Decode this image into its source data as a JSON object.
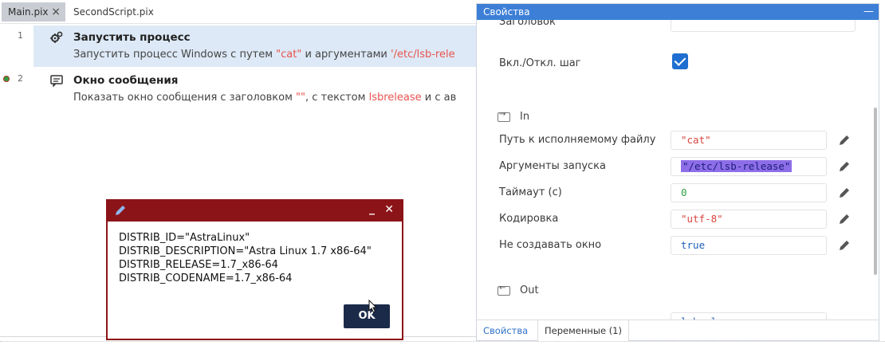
{
  "tabs": [
    {
      "label": "Main.pix",
      "active": true
    },
    {
      "label": "SecondScript.pix",
      "active": false
    }
  ],
  "steps": [
    {
      "number": "1",
      "title": "Запустить процесс",
      "desc_prefix": "Запустить процесс Windows с путем ",
      "desc_value1": "\"cat\"",
      "desc_mid": " и аргументами ",
      "desc_value2": "'/etc/lsb-rele",
      "icon": "gears-icon"
    },
    {
      "number": "2",
      "title": "Окно сообщения",
      "desc_prefix": "Показать окно сообщения с заголовком ",
      "desc_value1": "\"\"",
      "desc_mid": ", с текстом ",
      "desc_value2": "lsbrelease",
      "desc_suffix": " и с ав",
      "icon": "message-icon"
    }
  ],
  "properties": {
    "title": "Свойства",
    "title_partial_label": "Заголовок",
    "toggle_label": "Вкл./Откл. шаг",
    "toggle_checked": true,
    "section_in": "In",
    "section_out": "Out",
    "fields": [
      {
        "label": "Путь к исполняемому файлу",
        "value": "\"cat\"",
        "color": "red"
      },
      {
        "label": "Аргументы запуска",
        "value": "\"/etc/lsb-release\"",
        "color": "selected"
      },
      {
        "label": "Таймаут (с)",
        "value": "0",
        "color": "green"
      },
      {
        "label": "Кодировка",
        "value": "\"utf-8\"",
        "color": "red"
      },
      {
        "label": "Не создавать окно",
        "value": "true",
        "color": "blue"
      }
    ],
    "out_partial_value": "lsbrel",
    "bottom_tabs": [
      "Свойства",
      "Переменные (1)"
    ]
  },
  "dialog": {
    "lines": "DISTRIB_ID=\"AstraLinux\"\nDISTRIB_DESCRIPTION=\"Astra Linux 1.7 x86-64\"\nDISTRIB_RELEASE=1.7_x86-64\nDISTRIB_CODENAME=1.7_x86-64",
    "ok_label": "OK",
    "minimize_label": "_",
    "close_label": "✕"
  },
  "colors": {
    "accent": "#3d7fd6",
    "dialog_border": "#8b1418",
    "ok_button": "#1b2a49",
    "highlight_row": "#dde9f6",
    "value_red": "#e8544f"
  }
}
